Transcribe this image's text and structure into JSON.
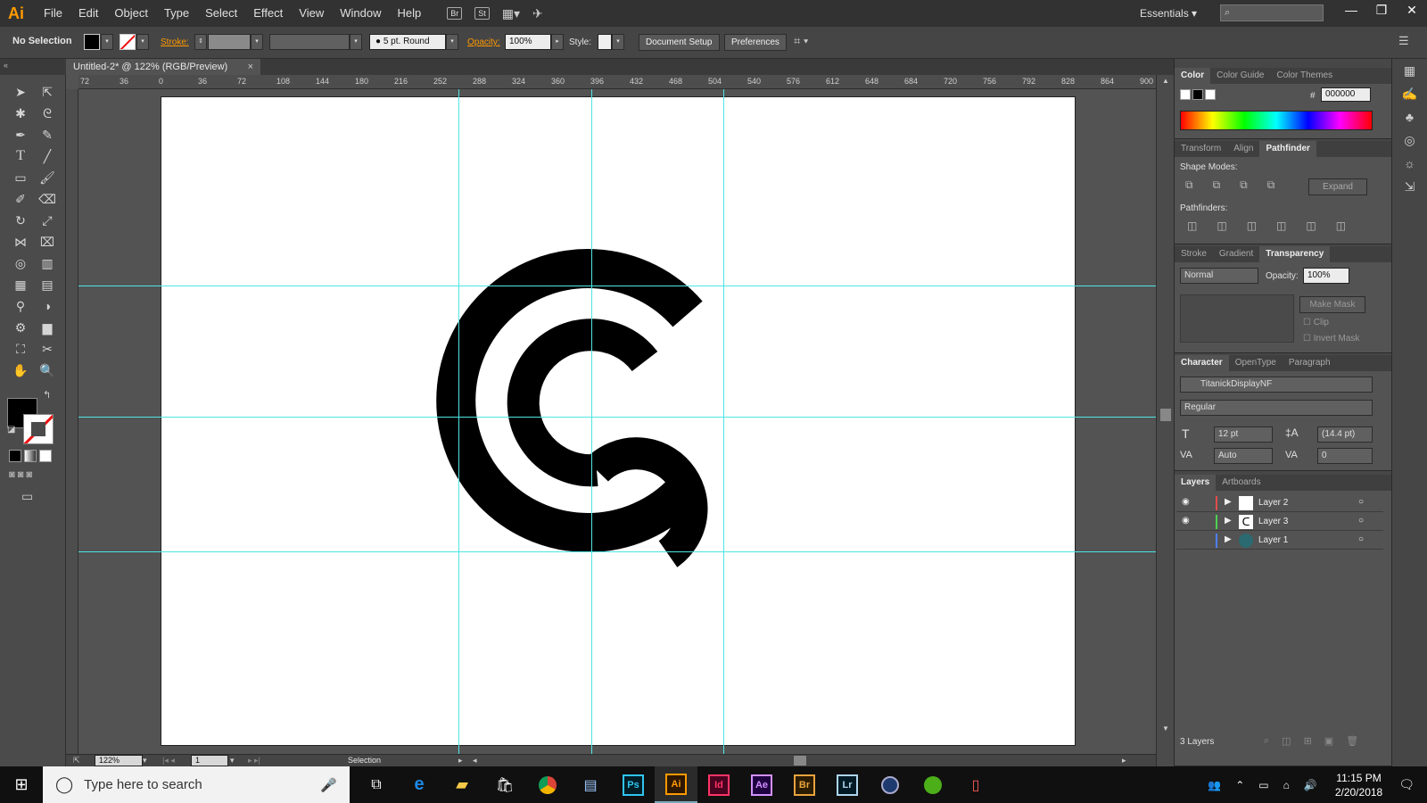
{
  "app": {
    "logo": "Ai"
  },
  "menu": [
    "File",
    "Edit",
    "Object",
    "Type",
    "Select",
    "Effect",
    "View",
    "Window",
    "Help"
  ],
  "topbar": {
    "bridge": "Br",
    "stock": "St",
    "workspace": "Essentials",
    "search_placeholder": ""
  },
  "window_controls": {
    "minimize": "—",
    "restore": "❐",
    "close": "✕"
  },
  "control": {
    "selection": "No Selection",
    "stroke_label": "Stroke:",
    "brush": "5 pt. Round",
    "opacity_label": "Opacity:",
    "opacity_value": "100%",
    "style_label": "Style:",
    "doc_setup": "Document Setup",
    "preferences": "Preferences"
  },
  "document_tab": {
    "title": "Untitled-2* @ 122% (RGB/Preview)",
    "close": "×"
  },
  "ruler_ticks": [
    "72",
    "36",
    "0",
    "36",
    "72",
    "108",
    "144",
    "180",
    "216",
    "252",
    "288",
    "324",
    "360",
    "396",
    "432",
    "468",
    "504",
    "540",
    "576",
    "612",
    "648",
    "684",
    "720",
    "756",
    "792",
    "828",
    "864",
    "900"
  ],
  "status": {
    "zoom": "122%",
    "artboard_num": "1",
    "tool": "Selection"
  },
  "color_panel": {
    "tabs": [
      "Color",
      "Color Guide",
      "Color Themes"
    ],
    "hash": "#",
    "hex": "000000"
  },
  "transform_panel": {
    "tabs": [
      "Transform",
      "Align",
      "Pathfinder"
    ],
    "shape_modes": "Shape Modes:",
    "pathfinders": "Pathfinders:",
    "expand": "Expand"
  },
  "transparency_panel": {
    "tabs": [
      "Stroke",
      "Gradient",
      "Transparency"
    ],
    "blend": "Normal",
    "opacity_label": "Opacity:",
    "opacity": "100%",
    "make_mask": "Make Mask",
    "clip": "Clip",
    "invert": "Invert Mask"
  },
  "character_panel": {
    "tabs": [
      "Character",
      "OpenType",
      "Paragraph"
    ],
    "font": "TitanickDisplayNF",
    "style": "Regular",
    "size": "12 pt",
    "leading": "(14.4 pt)",
    "kerning": "Auto",
    "tracking": "0"
  },
  "layers_panel": {
    "tabs": [
      "Layers",
      "Artboards"
    ],
    "layers": [
      {
        "name": "Layer 2",
        "color": "#E14D4D"
      },
      {
        "name": "Layer 3",
        "color": "#4FD14F"
      },
      {
        "name": "Layer 1",
        "color": "#4F7FFF"
      }
    ],
    "count": "3 Layers"
  },
  "taskbar": {
    "search_placeholder": "Type here to search",
    "apps": [
      {
        "name": "Ps",
        "color": "#31C5F0"
      },
      {
        "name": "Ai",
        "color": "#FF9A00"
      },
      {
        "name": "Id",
        "color": "#FF3366"
      },
      {
        "name": "Ae",
        "color": "#D291FF"
      },
      {
        "name": "Br",
        "color": "#E8A33D"
      },
      {
        "name": "Lr",
        "color": "#ADD5EC"
      }
    ],
    "time": "11:15 PM",
    "date": "2/20/2018"
  }
}
